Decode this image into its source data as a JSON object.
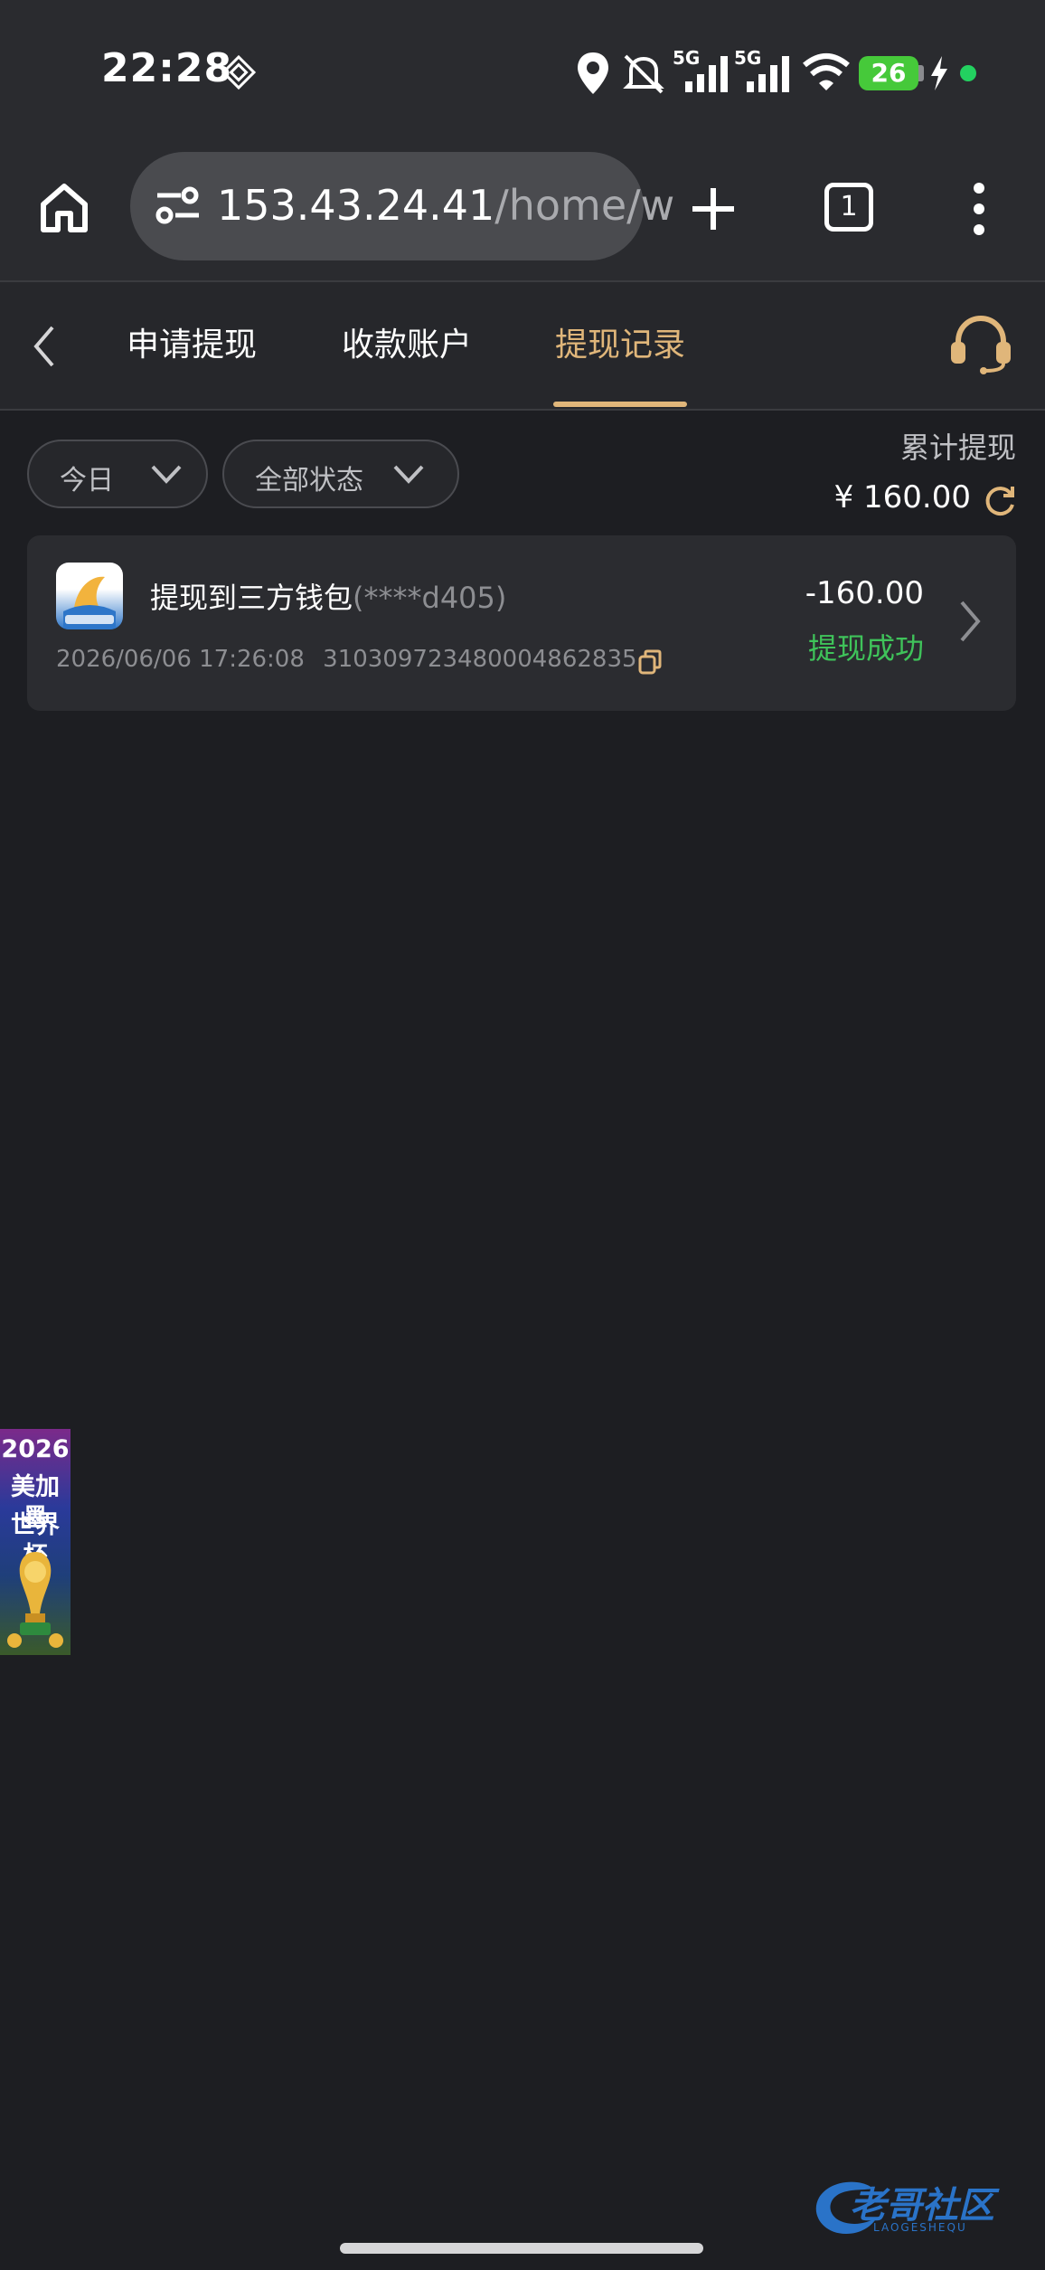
{
  "status_bar": {
    "time": "22:28",
    "network_1": "5G",
    "network_2": "5G",
    "battery": "26"
  },
  "browser": {
    "url_host": "153.43.24.41",
    "url_path": "/home/w",
    "tab_count": "1"
  },
  "nav": {
    "tabs": [
      {
        "label": "申请提现",
        "active": false
      },
      {
        "label": "收款账户",
        "active": false
      },
      {
        "label": "提现记录",
        "active": true
      }
    ],
    "accent_color": "#e0b67a"
  },
  "filters": {
    "date": "今日",
    "status": "全部状态"
  },
  "summary": {
    "label": "累计提现",
    "value": "¥ 160.00"
  },
  "records": [
    {
      "title": "提现到三方钱包",
      "account_mask": "(****d405)",
      "datetime": "2026/06/06 17:26:08",
      "order_id": "310309723480004862835",
      "amount": "-160.00",
      "status": "提现成功",
      "status_color": "#3fc35a"
    }
  ],
  "banner": {
    "lines": [
      "2026",
      "美加墨",
      "世界杯"
    ]
  },
  "watermark": {
    "text": "老哥社区",
    "sub": "LAOGESHEQU"
  }
}
